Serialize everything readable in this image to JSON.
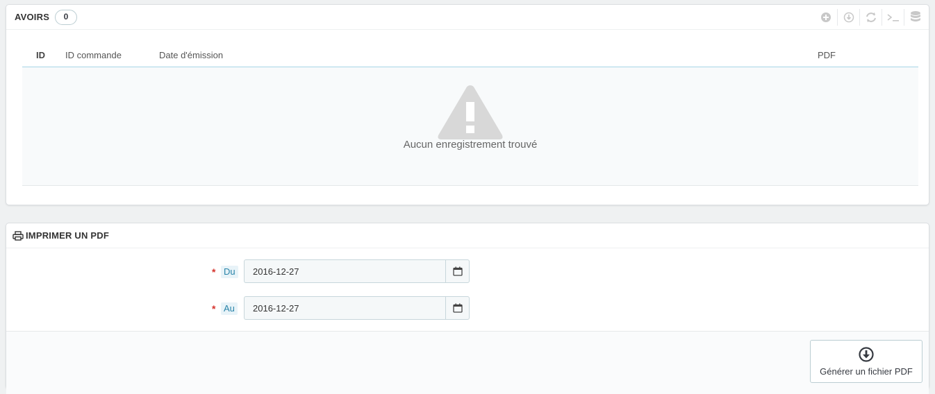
{
  "avoirs": {
    "title": "AVOIRS",
    "count": "0",
    "columns": {
      "id": "ID",
      "order_id": "ID commande",
      "date": "Date d'émission",
      "pdf": "PDF"
    },
    "empty_message": "Aucun enregistrement trouvé",
    "toolbar_icons": [
      "add-icon",
      "export-icon",
      "refresh-icon",
      "sql-query-icon",
      "database-icon"
    ]
  },
  "print_pdf": {
    "title": "IMPRIMER UN PDF",
    "from_label": "Du",
    "from_value": "2016-12-27",
    "to_label": "Au",
    "to_value": "2016-12-27",
    "required_mark": "*",
    "generate_label": "Générer un fichier PDF"
  },
  "colors": {
    "accent": "#25b9d7",
    "label_text": "#2883a8",
    "required": "#d5332c",
    "icon_gray": "#c8c8c8"
  }
}
